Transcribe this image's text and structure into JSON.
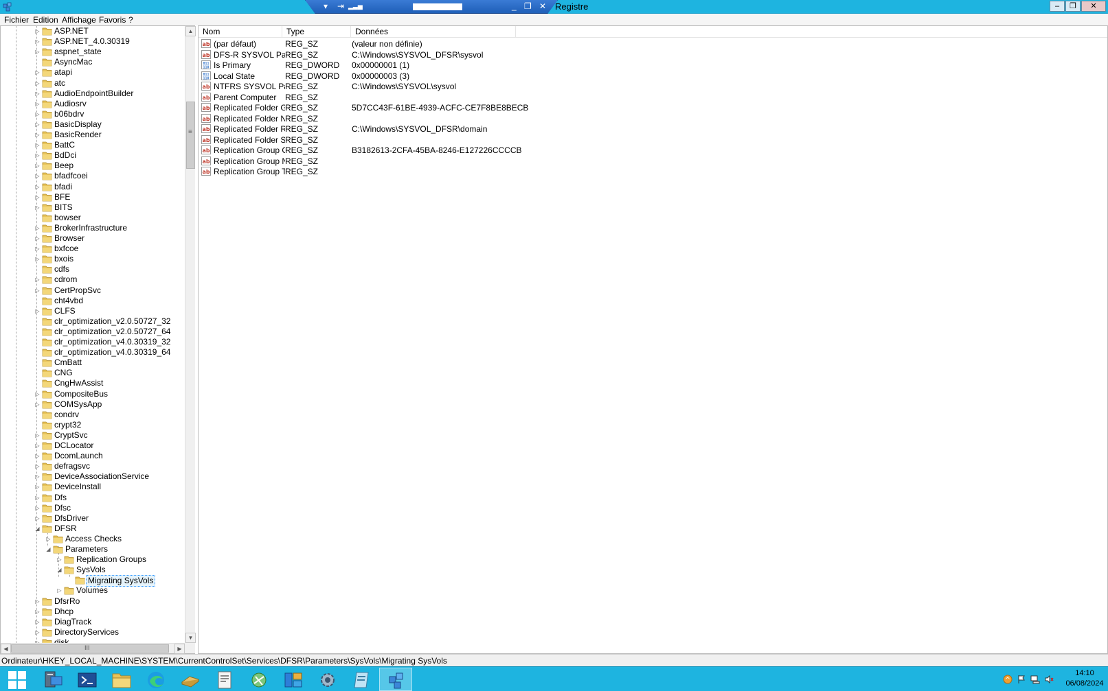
{
  "window": {
    "title": "Registre",
    "buttons": {
      "minimize": "–",
      "restore": "❐",
      "close": "✕"
    }
  },
  "rdp_bar": {
    "pin": "▾",
    "connection": "⇥",
    "signal": "▂▃▅",
    "minimize": "_",
    "restore": "❐",
    "close": "✕"
  },
  "menu": [
    "Fichier",
    "Edition",
    "Affichage",
    "Favoris",
    "?"
  ],
  "tree": {
    "rows": [
      {
        "label": "ASP.NET",
        "level": 0,
        "expander": "▷"
      },
      {
        "label": "ASP.NET_4.0.30319",
        "level": 0,
        "expander": "▷"
      },
      {
        "label": "aspnet_state",
        "level": 0,
        "expander": "▷"
      },
      {
        "label": "AsyncMac",
        "level": 0,
        "expander": ""
      },
      {
        "label": "atapi",
        "level": 0,
        "expander": "▷"
      },
      {
        "label": "atc",
        "level": 0,
        "expander": "▷"
      },
      {
        "label": "AudioEndpointBuilder",
        "level": 0,
        "expander": "▷"
      },
      {
        "label": "Audiosrv",
        "level": 0,
        "expander": "▷"
      },
      {
        "label": "b06bdrv",
        "level": 0,
        "expander": "▷"
      },
      {
        "label": "BasicDisplay",
        "level": 0,
        "expander": "▷"
      },
      {
        "label": "BasicRender",
        "level": 0,
        "expander": "▷"
      },
      {
        "label": "BattC",
        "level": 0,
        "expander": "▷"
      },
      {
        "label": "BdDci",
        "level": 0,
        "expander": "▷"
      },
      {
        "label": "Beep",
        "level": 0,
        "expander": "▷"
      },
      {
        "label": "bfadfcoei",
        "level": 0,
        "expander": "▷"
      },
      {
        "label": "bfadi",
        "level": 0,
        "expander": "▷"
      },
      {
        "label": "BFE",
        "level": 0,
        "expander": "▷"
      },
      {
        "label": "BITS",
        "level": 0,
        "expander": "▷"
      },
      {
        "label": "bowser",
        "level": 0,
        "expander": ""
      },
      {
        "label": "BrokerInfrastructure",
        "level": 0,
        "expander": "▷"
      },
      {
        "label": "Browser",
        "level": 0,
        "expander": "▷"
      },
      {
        "label": "bxfcoe",
        "level": 0,
        "expander": "▷"
      },
      {
        "label": "bxois",
        "level": 0,
        "expander": "▷"
      },
      {
        "label": "cdfs",
        "level": 0,
        "expander": ""
      },
      {
        "label": "cdrom",
        "level": 0,
        "expander": "▷"
      },
      {
        "label": "CertPropSvc",
        "level": 0,
        "expander": "▷"
      },
      {
        "label": "cht4vbd",
        "level": 0,
        "expander": ""
      },
      {
        "label": "CLFS",
        "level": 0,
        "expander": "▷"
      },
      {
        "label": "clr_optimization_v2.0.50727_32",
        "level": 0,
        "expander": ""
      },
      {
        "label": "clr_optimization_v2.0.50727_64",
        "level": 0,
        "expander": ""
      },
      {
        "label": "clr_optimization_v4.0.30319_32",
        "level": 0,
        "expander": ""
      },
      {
        "label": "clr_optimization_v4.0.30319_64",
        "level": 0,
        "expander": ""
      },
      {
        "label": "CmBatt",
        "level": 0,
        "expander": ""
      },
      {
        "label": "CNG",
        "level": 0,
        "expander": ""
      },
      {
        "label": "CngHwAssist",
        "level": 0,
        "expander": ""
      },
      {
        "label": "CompositeBus",
        "level": 0,
        "expander": "▷"
      },
      {
        "label": "COMSysApp",
        "level": 0,
        "expander": "▷"
      },
      {
        "label": "condrv",
        "level": 0,
        "expander": ""
      },
      {
        "label": "crypt32",
        "level": 0,
        "expander": ""
      },
      {
        "label": "CryptSvc",
        "level": 0,
        "expander": "▷"
      },
      {
        "label": "DCLocator",
        "level": 0,
        "expander": "▷"
      },
      {
        "label": "DcomLaunch",
        "level": 0,
        "expander": "▷"
      },
      {
        "label": "defragsvc",
        "level": 0,
        "expander": "▷"
      },
      {
        "label": "DeviceAssociationService",
        "level": 0,
        "expander": "▷"
      },
      {
        "label": "DeviceInstall",
        "level": 0,
        "expander": "▷"
      },
      {
        "label": "Dfs",
        "level": 0,
        "expander": "▷"
      },
      {
        "label": "Dfsc",
        "level": 0,
        "expander": "▷"
      },
      {
        "label": "DfsDriver",
        "level": 0,
        "expander": "▷"
      },
      {
        "label": "DFSR",
        "level": 0,
        "expander": "◢"
      },
      {
        "label": "Access Checks",
        "level": 1,
        "expander": "▷"
      },
      {
        "label": "Parameters",
        "level": 1,
        "expander": "◢"
      },
      {
        "label": "Replication Groups",
        "level": 2,
        "expander": "▷"
      },
      {
        "label": "SysVols",
        "level": 2,
        "expander": "◢"
      },
      {
        "label": "Migrating SysVols",
        "level": 3,
        "expander": "",
        "selected": true
      },
      {
        "label": "Volumes",
        "level": 2,
        "expander": "▷"
      },
      {
        "label": "DfsrRo",
        "level": 0,
        "expander": "▷"
      },
      {
        "label": "Dhcp",
        "level": 0,
        "expander": "▷"
      },
      {
        "label": "DiagTrack",
        "level": 0,
        "expander": "▷"
      },
      {
        "label": "DirectoryServices",
        "level": 0,
        "expander": "▷"
      },
      {
        "label": "disk",
        "level": 0,
        "expander": "▷"
      }
    ]
  },
  "tree_scroll": {
    "up": "▲",
    "down": "▼",
    "left": "◀",
    "right": "▶",
    "thumb_grip": "≡",
    "h_thumb_grip": "III"
  },
  "list": {
    "columns": [
      "Nom",
      "Type",
      "Données"
    ],
    "rows": [
      {
        "name": "(par défaut)",
        "type": "REG_SZ",
        "data": "(valeur non définie)",
        "icon": "string-value-icon"
      },
      {
        "name": "DFS-R SYSVOL Path",
        "type": "REG_SZ",
        "data": "C:\\Windows\\SYSVOL_DFSR\\sysvol",
        "icon": "string-value-icon"
      },
      {
        "name": "Is Primary",
        "type": "REG_DWORD",
        "data": "0x00000001 (1)",
        "icon": "binary-value-icon"
      },
      {
        "name": "Local State",
        "type": "REG_DWORD",
        "data": "0x00000003 (3)",
        "icon": "binary-value-icon"
      },
      {
        "name": "NTFRS SYSVOL Path",
        "type": "REG_SZ",
        "data": "C:\\Windows\\SYSVOL\\sysvol",
        "icon": "string-value-icon"
      },
      {
        "name": "Parent Computer",
        "type": "REG_SZ",
        "data": "",
        "icon": "string-value-icon"
      },
      {
        "name": "Replicated Folder Guid",
        "type": "REG_SZ",
        "data": "5D7CC43F-61BE-4939-ACFC-CE7F8BE8BECB",
        "icon": "string-value-icon"
      },
      {
        "name": "Replicated Folder Name",
        "type": "REG_SZ",
        "data": "",
        "icon": "string-value-icon"
      },
      {
        "name": "Replicated Folder Root",
        "type": "REG_SZ",
        "data": "C:\\Windows\\SYSVOL_DFSR\\domain",
        "icon": "string-value-icon"
      },
      {
        "name": "Replicated Folder Stage",
        "type": "REG_SZ",
        "data": "",
        "icon": "string-value-icon"
      },
      {
        "name": "Replication Group Guid",
        "type": "REG_SZ",
        "data": "B3182613-2CFA-45BA-8246-E127226CCCCB",
        "icon": "string-value-icon"
      },
      {
        "name": "Replication Group Na...",
        "type": "REG_SZ",
        "data": "",
        "icon": "string-value-icon"
      },
      {
        "name": "Replication Group Type",
        "type": "REG_SZ",
        "data": "",
        "icon": "string-value-icon"
      }
    ]
  },
  "statusbar": {
    "path": "Ordinateur\\HKEY_LOCAL_MACHINE\\SYSTEM\\CurrentControlSet\\Services\\DFSR\\Parameters\\SysVols\\Migrating SysVols"
  },
  "taskbar": {
    "buttons": [
      {
        "name": "start-button",
        "icon": "windows-logo-icon"
      },
      {
        "name": "server-manager-button",
        "icon": "server-manager-icon"
      },
      {
        "name": "powershell-button",
        "icon": "powershell-icon"
      },
      {
        "name": "file-explorer-button",
        "icon": "folder-icon"
      },
      {
        "name": "edge-button",
        "icon": "edge-icon"
      },
      {
        "name": "disk-tool-button",
        "icon": "disk-icon"
      },
      {
        "name": "document-button",
        "icon": "document-icon"
      },
      {
        "name": "network-tool-button",
        "icon": "network-icon"
      },
      {
        "name": "app-button",
        "icon": "app-grid-icon"
      },
      {
        "name": "services-button",
        "icon": "gear-icon"
      },
      {
        "name": "notepad-button",
        "icon": "notepad-icon"
      },
      {
        "name": "regedit-button",
        "icon": "regedit-icon",
        "active": true
      }
    ],
    "tray_icons": [
      "warning-icon",
      "flag-icon",
      "network-icon",
      "volume-muted-icon"
    ],
    "time": "14:10",
    "date": "06/08/2024"
  },
  "colors": {
    "taskbar": "#1eb4e0",
    "titlebar": "#1eb4e0",
    "folder": "#e8c45a",
    "string_icon": "#c0392b",
    "binary_icon": "#2a6fc9"
  }
}
